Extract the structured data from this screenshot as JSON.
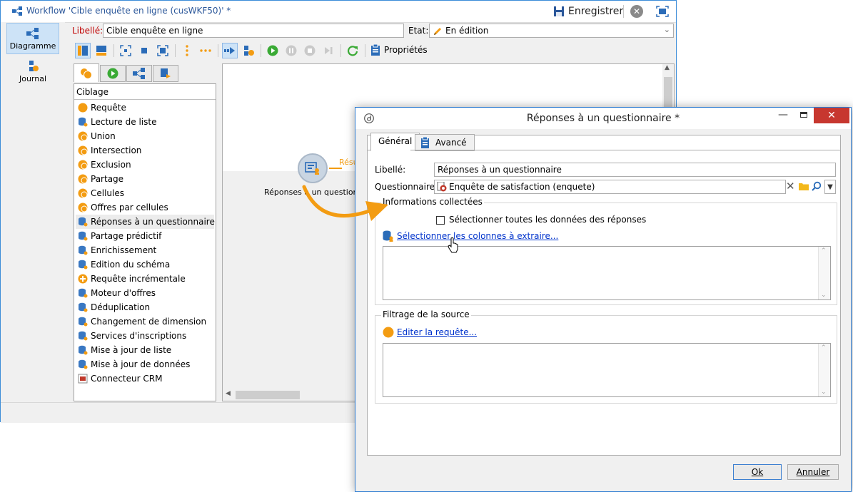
{
  "main_window": {
    "title": "Workflow 'Cible enquête en ligne (cusWKF50)' *",
    "save_label": "Enregistrer",
    "nav": [
      {
        "label": "Diagramme",
        "icon": "diagram-icon",
        "active": true
      },
      {
        "label": "Journal",
        "icon": "journal-icon",
        "active": false
      }
    ],
    "label_field": {
      "label": "Libellé:",
      "value": "Cible enquête en ligne"
    },
    "state_field": {
      "label": "Etat:",
      "value": "En édition"
    },
    "properties_label": "Propriétés",
    "palette": {
      "header": "Ciblage",
      "items": [
        {
          "label": "Requête",
          "icon": "query-icon",
          "color": "#f39c12"
        },
        {
          "label": "Lecture de liste",
          "icon": "list-read-icon",
          "color": "#3a78c2"
        },
        {
          "label": "Union",
          "icon": "union-icon",
          "color": "#f39c12"
        },
        {
          "label": "Intersection",
          "icon": "intersection-icon",
          "color": "#f39c12"
        },
        {
          "label": "Exclusion",
          "icon": "exclusion-icon",
          "color": "#f39c12"
        },
        {
          "label": "Partage",
          "icon": "split-icon",
          "color": "#f39c12"
        },
        {
          "label": "Cellules",
          "icon": "cells-icon",
          "color": "#f39c12"
        },
        {
          "label": "Offres par cellules",
          "icon": "offers-cells-icon",
          "color": "#f39c12"
        },
        {
          "label": "Réponses à un questionnaire",
          "icon": "survey-responses-icon",
          "color": "#3a78c2"
        },
        {
          "label": "Partage prédictif",
          "icon": "predictive-split-icon",
          "color": "#3a78c2"
        },
        {
          "label": "Enrichissement",
          "icon": "enrichment-icon",
          "color": "#3a78c2"
        },
        {
          "label": "Edition du schéma",
          "icon": "schema-edit-icon",
          "color": "#3a78c2"
        },
        {
          "label": "Requête incrémentale",
          "icon": "incremental-query-icon",
          "color": "#f39c12"
        },
        {
          "label": "Moteur d'offres",
          "icon": "offer-engine-icon",
          "color": "#3a78c2"
        },
        {
          "label": "Déduplication",
          "icon": "deduplication-icon",
          "color": "#3a78c2"
        },
        {
          "label": "Changement de dimension",
          "icon": "dimension-change-icon",
          "color": "#3a78c2"
        },
        {
          "label": "Services d'inscriptions",
          "icon": "subscription-services-icon",
          "color": "#3a78c2"
        },
        {
          "label": "Mise à jour de liste",
          "icon": "list-update-icon",
          "color": "#3a78c2"
        },
        {
          "label": "Mise à jour de données",
          "icon": "data-update-icon",
          "color": "#3a78c2"
        },
        {
          "label": "Connecteur CRM",
          "icon": "crm-connector-icon",
          "color": "#c0392b"
        }
      ],
      "selected_index": 8
    },
    "canvas": {
      "node_label": "Réponses à un questionnaire",
      "transition_label": "Résu"
    }
  },
  "dialog": {
    "title": "Réponses à un questionnaire *",
    "tabs": [
      {
        "label": "Général",
        "active": true
      },
      {
        "label": "Avancé",
        "active": false
      }
    ],
    "label_field": {
      "label": "Libellé:",
      "value": "Réponses à un questionnaire"
    },
    "survey_field": {
      "label": "Questionnaire:",
      "value": "Enquête de satisfaction (enquete)"
    },
    "collected_group": {
      "title": "Informations collectées",
      "checkbox_label": "Sélectionner toutes les données des réponses",
      "checkbox_checked": false,
      "link": "Sélectionner les colonnes à extraire..."
    },
    "filter_group": {
      "title": "Filtrage de la source",
      "link": "Editer la requête..."
    },
    "ok_label": "Ok",
    "cancel_label": "Annuler"
  },
  "colors": {
    "accent_blue": "#2b579a",
    "orange": "#f39c12",
    "link": "#0033cc",
    "required_label": "#c00000",
    "close_red": "#c7372f"
  }
}
